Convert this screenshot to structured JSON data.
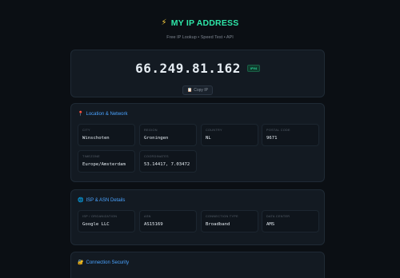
{
  "header": {
    "title": "MY IP ADDRESS",
    "subtitle": "Free IP Lookup • Speed Test • API"
  },
  "ip": {
    "address": "66.249.81.162",
    "version_badge": "IPv4",
    "copy_label": "Copy IP"
  },
  "location": {
    "title": "Location & Network",
    "fields": [
      {
        "label": "CITY",
        "value": "Winschoten"
      },
      {
        "label": "REGION",
        "value": "Groningen"
      },
      {
        "label": "COUNTRY",
        "value": "NL"
      },
      {
        "label": "POSTAL CODE",
        "value": "9671"
      },
      {
        "label": "TIMEZONE",
        "value": "Europe/Amsterdam"
      },
      {
        "label": "COORDINATES",
        "value": "53.14417, 7.03472"
      }
    ]
  },
  "isp": {
    "title": "ISP & ASN Details",
    "fields": [
      {
        "label": "ISP / ORGANIZATION",
        "value": "Google LLC"
      },
      {
        "label": "ASN",
        "value": "AS15169"
      },
      {
        "label": "CONNECTION TYPE",
        "value": "Broadband"
      },
      {
        "label": "DATA CENTER",
        "value": "AMS"
      }
    ]
  },
  "security": {
    "title": "Connection Security"
  },
  "icons": {
    "title_icon": "lightning-bolt-icon",
    "copy_icon": "clipboard-icon",
    "location_icon": "map-pin-icon",
    "isp_icon": "globe-icon",
    "security_icon": "lock-icon"
  },
  "colors": {
    "background": "#0b0f14",
    "card": "#131a22",
    "accent_green": "#2ee6a8",
    "accent_blue": "#4aa3ff",
    "bolt_yellow": "#ffd23f"
  }
}
